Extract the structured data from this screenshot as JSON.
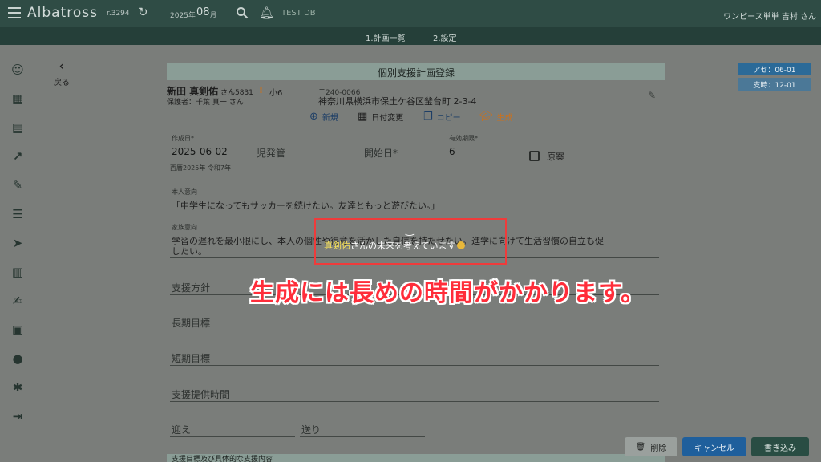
{
  "header": {
    "app_name": "Albatross",
    "revision": "r.3294",
    "year": "2025年",
    "month": "08",
    "month_suffix": "月",
    "db_name": "TEST DB",
    "user": "ワンピース単単 吉村 さん"
  },
  "subnav": {
    "tabs": [
      "1.計画一覧",
      "2.設定"
    ]
  },
  "sidebar": {
    "icons": [
      "smile-icon",
      "calendar-icon",
      "document-icon",
      "trending-up-icon",
      "edit-icon",
      "sliders-icon",
      "send-icon",
      "book-icon",
      "person-edit-icon",
      "event-icon",
      "account-circle-icon",
      "bug-icon",
      "exit-icon"
    ]
  },
  "back_label": "戻る",
  "form": {
    "title": "個別支援計画登録",
    "child_name": "新田 真剣佑",
    "child_suffix": "さん5831",
    "grade": "小6",
    "guardian": "保護者：千葉 真一 さん",
    "postal": "〒240-0066",
    "address": "神奈川県横浜市保土ケ谷区釜台町 2-3-4",
    "actions": {
      "new": "新規",
      "date_change": "日付変更",
      "copy": "コピー",
      "generate": "生成"
    },
    "created_label": "作成日*",
    "created_value": "2025-06-02",
    "era_note": "西暦2025年 令和7年",
    "manager_placeholder": "児発管",
    "start_placeholder": "開始日*",
    "validity_label": "有効期限*",
    "validity_value": "6",
    "draft_label": "原案",
    "intent_label": "本人意向",
    "intent_value": "「中学生になってもサッカーを続けたい。友達ともっと遊びたい。」",
    "family_label": "家族意向",
    "family_value_line1": "学習の遅れを最小限にし、本人の個性や得意を活かした自信を持たせたい。進学に向けて生活習慣の自立も促",
    "family_value_line2": "したい。",
    "policy_placeholder": "支援方針",
    "long_goal_placeholder": "長期目標",
    "short_goal_placeholder": "短期目標",
    "hours_placeholder": "支援提供時間",
    "pickup_placeholder": "迎え",
    "dropoff_placeholder": "送り",
    "bottom_section": "支援目標及び具体的な支援内容"
  },
  "badges": {
    "assessment": "アセ：06-01",
    "support": "支時：12-01"
  },
  "overlay": {
    "spinner": "‿",
    "name": "真剣佑",
    "message": "さんの未来を考えています"
  },
  "caption": "生成には長めの時間がかかります。",
  "buttons": {
    "delete": "削除",
    "cancel": "キャンセル",
    "save": "書き込み"
  },
  "colors": {
    "header_bg": "#2f4c45",
    "accent_orange": "#c9711e",
    "cancel_blue": "#1f5f9c",
    "save_green": "#294d43",
    "caption_red": "#ff2d3a"
  }
}
